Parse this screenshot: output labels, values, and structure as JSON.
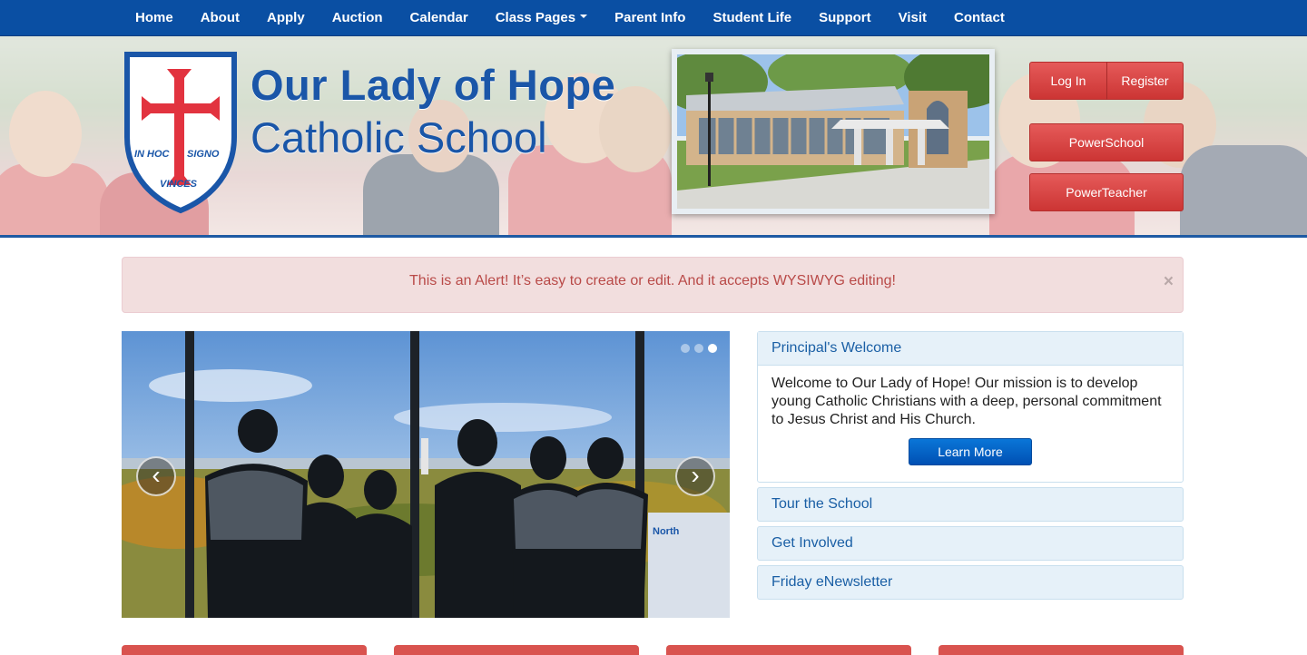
{
  "nav": {
    "items": [
      {
        "label": "Home"
      },
      {
        "label": "About"
      },
      {
        "label": "Apply"
      },
      {
        "label": "Auction"
      },
      {
        "label": "Calendar"
      },
      {
        "label": "Class Pages",
        "dropdown": true
      },
      {
        "label": "Parent Info"
      },
      {
        "label": "Student Life"
      },
      {
        "label": "Support"
      },
      {
        "label": "Visit"
      },
      {
        "label": "Contact"
      }
    ]
  },
  "header": {
    "title_line1": "Our Lady of Hope",
    "title_line2": "Catholic School",
    "shield_text": {
      "left": "IN HOC",
      "right": "SIGNO",
      "bottom": "VINCES"
    },
    "buttons": {
      "login": "Log In",
      "register": "Register",
      "powerschool": "PowerSchool",
      "powerteacher": "PowerTeacher"
    }
  },
  "alert": {
    "text": "This is an Alert! It’s easy to create or edit. And it accepts WYSIWYG editing!",
    "close": "×"
  },
  "carousel": {
    "prev": "‹",
    "next": "›",
    "slide_count": 3,
    "active_slide": 3,
    "sign_text": "North"
  },
  "accordion": {
    "panels": [
      {
        "title": "Principal's Welcome",
        "body": "Welcome to Our Lady of Hope! Our mission is to develop young Catholic Christians with a deep, personal commitment to Jesus Christ and His Church.",
        "button": "Learn More",
        "open": true
      },
      {
        "title": "Tour the School",
        "open": false
      },
      {
        "title": "Get Involved",
        "open": false
      },
      {
        "title": "Friday eNewsletter",
        "open": false
      }
    ]
  },
  "colors": {
    "nav_bg": "#0a4fa3",
    "brand_blue": "#1a56a8",
    "red_button": "#d9534f",
    "alert_bg": "#f2dede",
    "alert_text": "#b94a48",
    "accordion_bg": "#e6f1f9",
    "learn_more_blue": "#0a66c8"
  }
}
